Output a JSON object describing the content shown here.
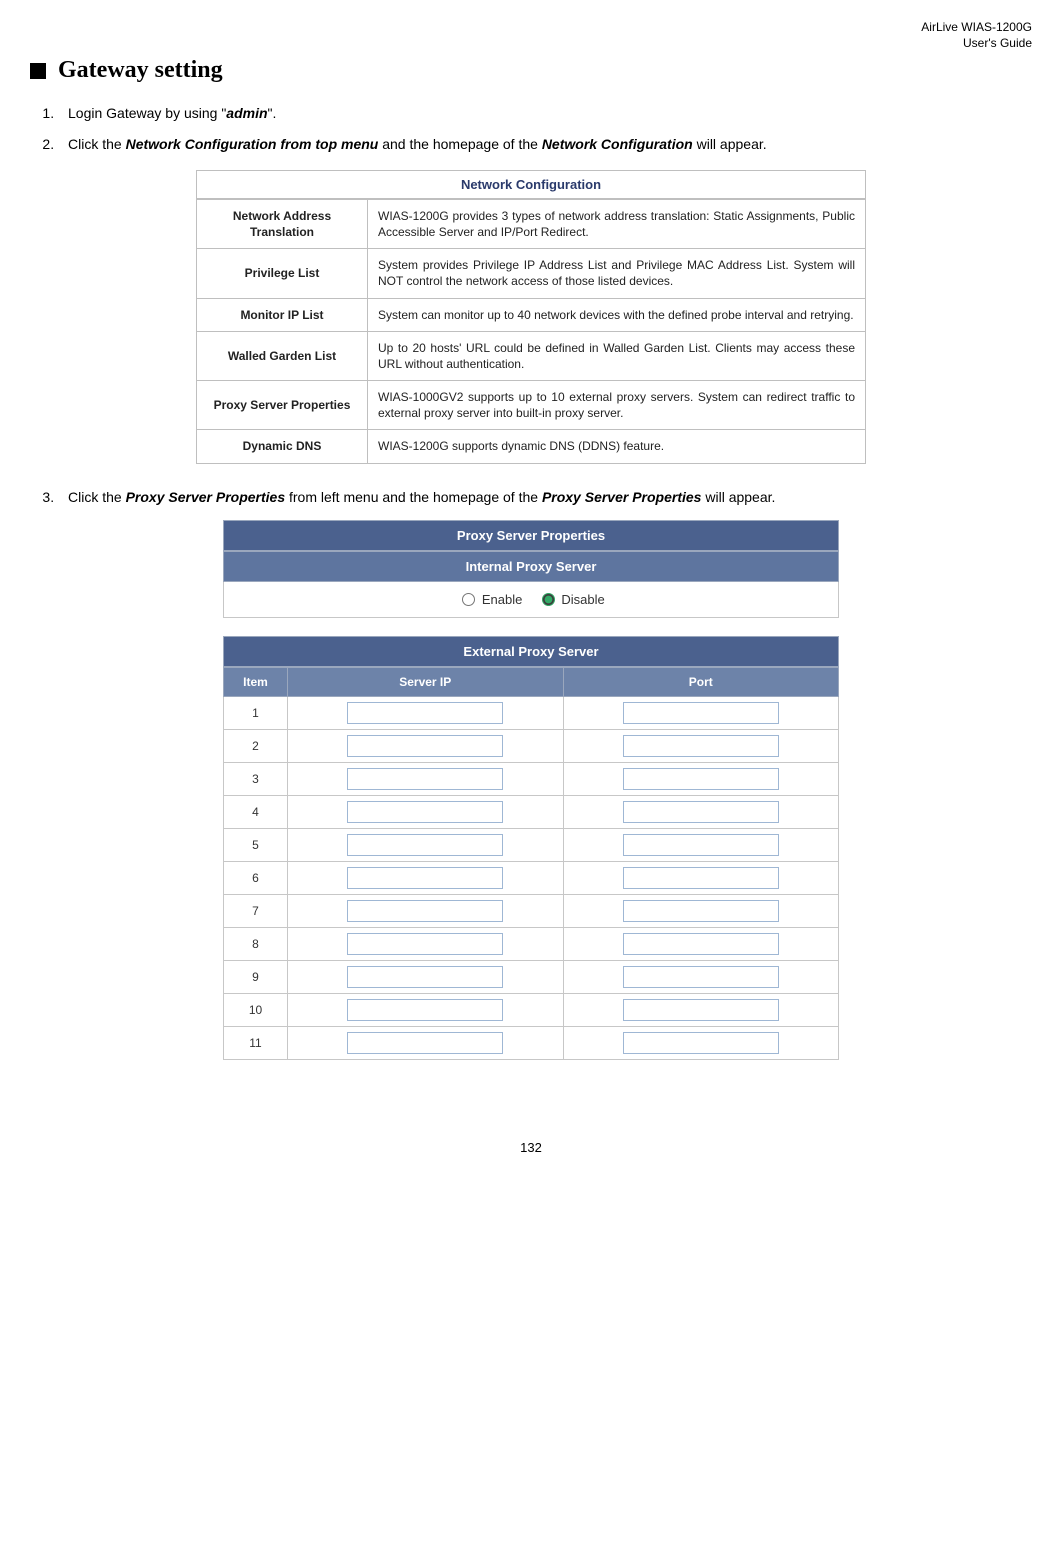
{
  "header": {
    "line1": "AirLive WIAS-1200G",
    "line2": "User's Guide"
  },
  "section_title": "Gateway setting",
  "steps": {
    "s1_pre": "Login Gateway by using \"",
    "s1_admin": "admin",
    "s1_post": "\".",
    "s2_pre": "Click the ",
    "s2_b1": "Network Configuration from top menu",
    "s2_mid": " and the homepage of the ",
    "s2_b2": "Network Configuration",
    "s2_post": " will appear.",
    "s3_pre": "Click the ",
    "s3_b1": "Proxy Server Properties",
    "s3_mid": " from left menu and the homepage of the ",
    "s3_b2": "Proxy Server Properties",
    "s3_post": " will appear."
  },
  "netcfg": {
    "title": "Network Configuration",
    "rows": [
      {
        "label": "Network Address Translation",
        "desc": "WIAS-1200G provides 3 types of network address translation: Static Assignments, Public Accessible Server and IP/Port Redirect."
      },
      {
        "label": "Privilege List",
        "desc": "System provides Privilege IP Address List and Privilege MAC Address List. System will NOT control the network access of those listed devices."
      },
      {
        "label": "Monitor IP List",
        "desc": "System can monitor up to 40 network devices with the defined probe interval and retrying."
      },
      {
        "label": "Walled Garden List",
        "desc": "Up to 20 hosts' URL could be defined in Walled Garden List. Clients may access these URL without authentication."
      },
      {
        "label": "Proxy Server Properties",
        "desc": "WIAS-1000GV2 supports up to 10 external proxy servers. System can redirect traffic to external proxy server into built-in proxy server."
      },
      {
        "label": "Dynamic DNS",
        "desc": "WIAS-1200G  supports dynamic DNS (DDNS) feature."
      }
    ]
  },
  "proxy": {
    "title": "Proxy Server Properties",
    "internal_title": "Internal Proxy Server",
    "enable_label": "Enable",
    "disable_label": "Disable",
    "ext_title": "External Proxy Server",
    "cols": {
      "item": "Item",
      "ip": "Server IP",
      "port": "Port"
    },
    "items": [
      "1",
      "2",
      "3",
      "4",
      "5",
      "6",
      "7",
      "8",
      "9",
      "10",
      "11"
    ]
  },
  "page_number": "132"
}
